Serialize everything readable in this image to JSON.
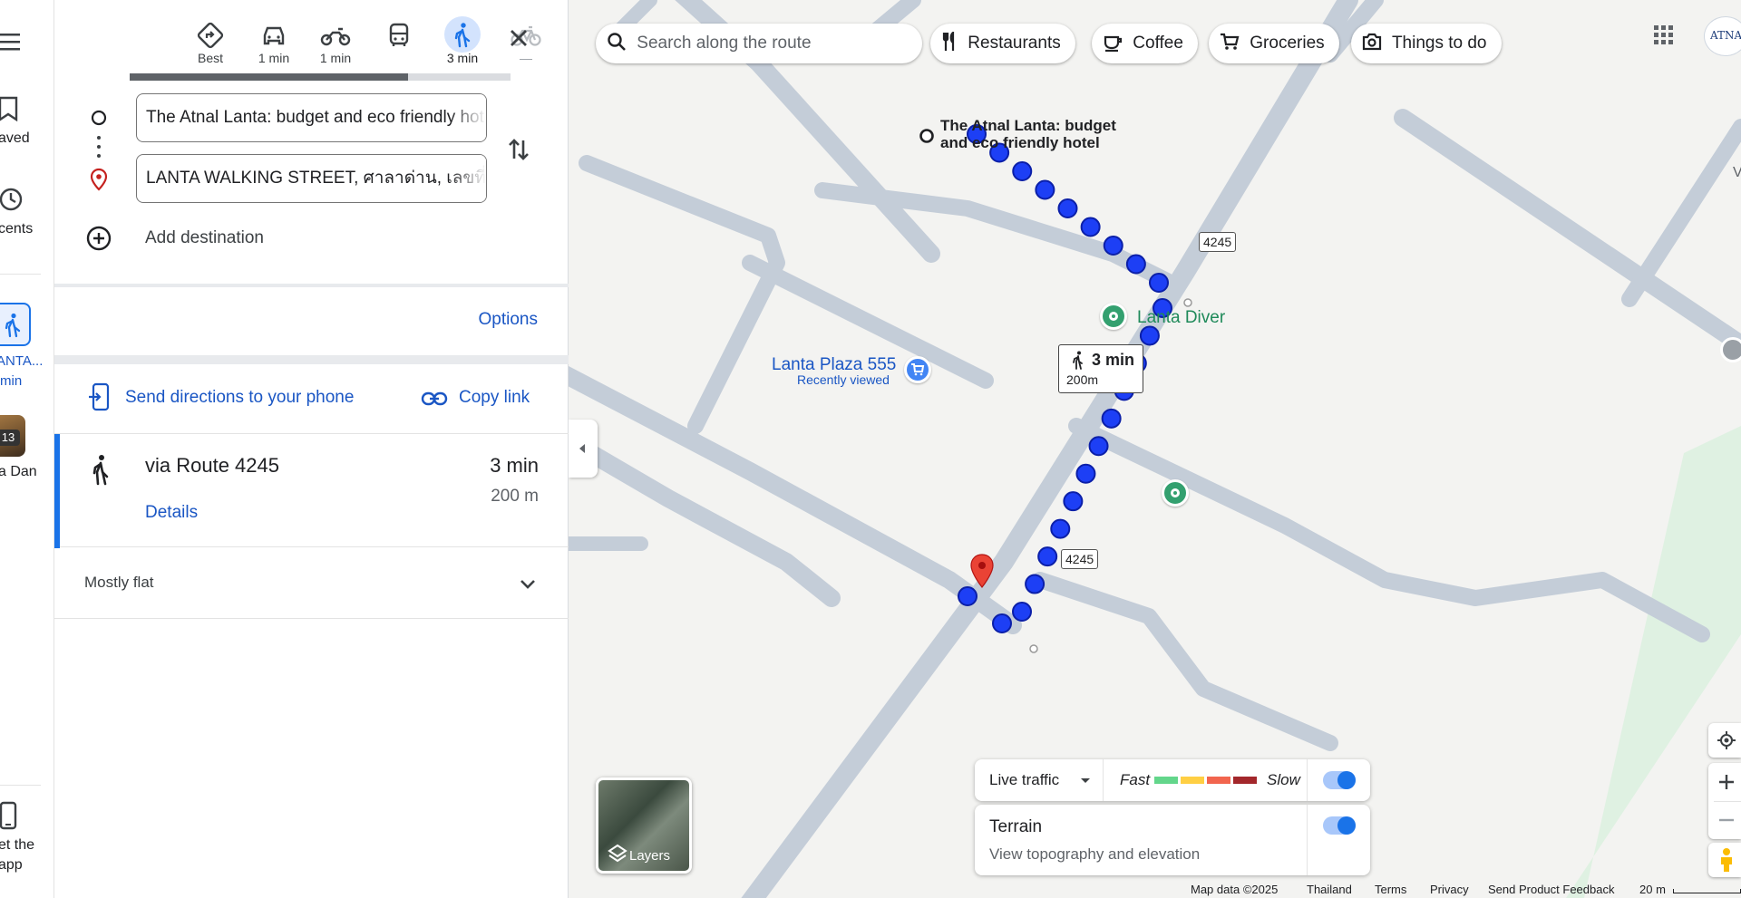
{
  "rail": {
    "saved_label": "aved",
    "recents_label": "cents",
    "recent_item_label": "ANTA...",
    "recent_item_sub": "min",
    "place_badge": "13",
    "place_label": "a Dan",
    "get_app_line1": "et the",
    "get_app_line2": "app"
  },
  "modes": [
    {
      "name": "Best",
      "time_label": "Best"
    },
    {
      "name": "Driving",
      "time_label": "1 min"
    },
    {
      "name": "Motorcycle",
      "time_label": "1 min"
    },
    {
      "name": "Transit",
      "time_label": ""
    },
    {
      "name": "Walking",
      "time_label": "3 min"
    },
    {
      "name": "Cycling",
      "time_label": "—"
    }
  ],
  "route_loading_progress": 0.73,
  "origin": {
    "value": "The Atnal Lanta: budget and eco friendly hotel"
  },
  "destination": {
    "value": "LANTA WALKING STREET, ศาลาด่าน, เลขที่"
  },
  "add_destination_label": "Add destination",
  "options_label": "Options",
  "send_directions_label": "Send directions to your phone",
  "copy_link_label": "Copy link",
  "route": {
    "via": "via Route 4245",
    "duration": "3 min",
    "distance": "200 m",
    "details_label": "Details"
  },
  "elevation_summary": "Mostly flat",
  "map": {
    "search_placeholder": "Search along the route",
    "chips": [
      "Restaurants",
      "Coffee",
      "Groceries",
      "Things to do"
    ],
    "origin_label_line1": "The Atnal Lanta: budget",
    "origin_label_line2": "and eco friendly hotel",
    "poi_lanta_diver": "Lanta Diver",
    "poi_lanta_plaza": "Lanta Plaza 555",
    "poi_lanta_plaza_sub": "Recently viewed",
    "route_shield": "4245",
    "walk_time": "3 min",
    "walk_distance": "200m",
    "profile_badge": "ATNAL",
    "right_edge_letter": "V",
    "layers_label": "Layers",
    "live_traffic_label": "Live traffic",
    "fast_label": "Fast",
    "slow_label": "Slow",
    "traffic_colors": [
      "#63d68b",
      "#ffcf43",
      "#f2654e",
      "#a3272b"
    ],
    "terrain_title": "Terrain",
    "terrain_desc": "View topography and elevation",
    "live_traffic_on": true,
    "terrain_on": true,
    "footer": {
      "map_data": "Map data ©2025",
      "country": "Thailand",
      "terms": "Terms",
      "privacy": "Privacy",
      "feedback": "Send Product Feedback",
      "scale": "20 m"
    }
  },
  "colors": {
    "accent_blue": "#1a73e8",
    "link_blue": "#1a56c4",
    "route_dot": "#1d3ff5",
    "road": "#c4cdd8",
    "park": "#dff1e2",
    "poi_green": "#33a06f",
    "pin_red": "#ea4335"
  }
}
